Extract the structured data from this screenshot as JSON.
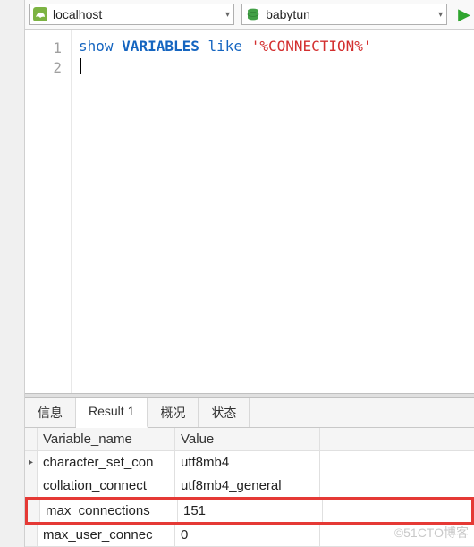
{
  "toolbar": {
    "connection": "localhost",
    "database": "babytun"
  },
  "editor": {
    "lines": [
      {
        "n": "1",
        "show": "show",
        "var": "VARIABLES",
        "like": "like",
        "str": "'%CONNECTION%'"
      },
      {
        "n": "2"
      }
    ]
  },
  "tabs": {
    "items": [
      {
        "label": "信息"
      },
      {
        "label": "Result 1"
      },
      {
        "label": "概况"
      },
      {
        "label": "状态"
      }
    ],
    "active": 1
  },
  "grid": {
    "columns": {
      "name": "Variable_name",
      "value": "Value"
    },
    "rows": [
      {
        "name": "character_set_con",
        "value": "utf8mb4",
        "current": true
      },
      {
        "name": "collation_connect",
        "value": "utf8mb4_general"
      },
      {
        "name": "max_connections",
        "value": "151",
        "highlight": true
      },
      {
        "name": "max_user_connec",
        "value": "0"
      }
    ]
  },
  "watermark": "©51CTO博客",
  "chart_data": {
    "type": "table",
    "title": "SHOW VARIABLES LIKE '%CONNECTION%'",
    "columns": [
      "Variable_name",
      "Value"
    ],
    "rows": [
      [
        "character_set_connection",
        "utf8mb4"
      ],
      [
        "collation_connection",
        "utf8mb4_general"
      ],
      [
        "max_connections",
        "151"
      ],
      [
        "max_user_connections",
        "0"
      ]
    ]
  }
}
